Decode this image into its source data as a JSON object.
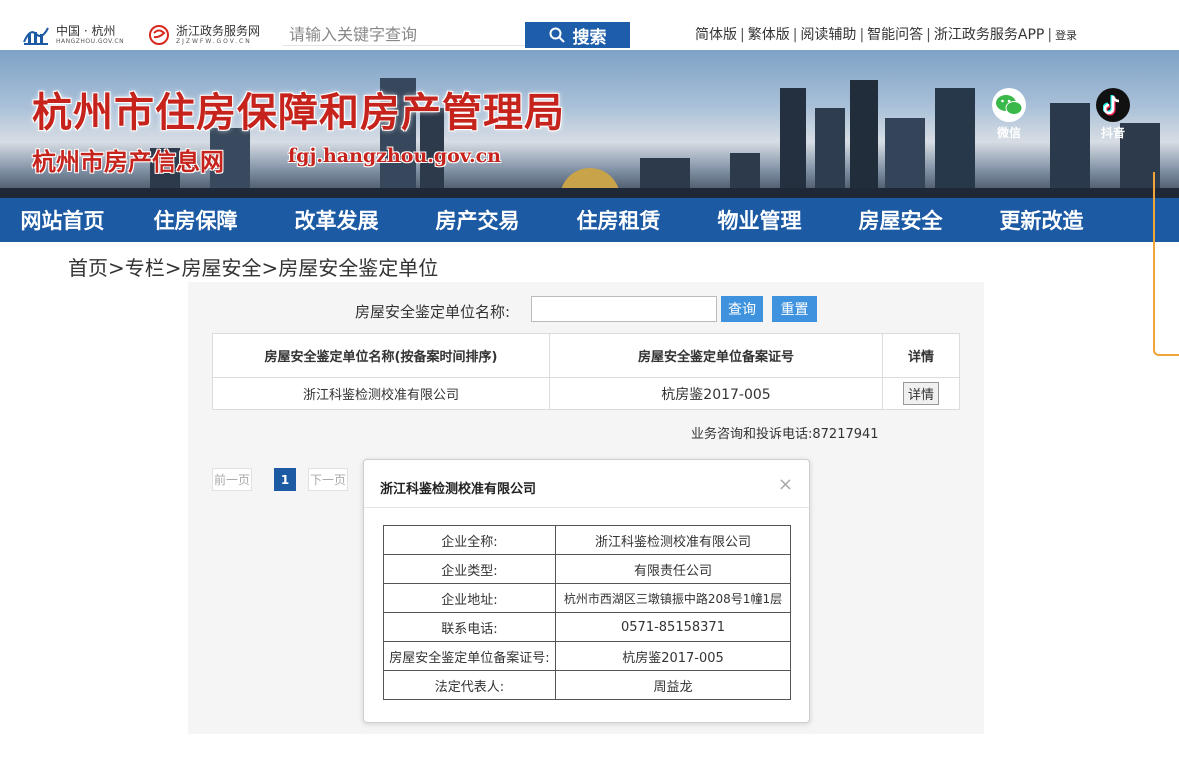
{
  "topbar": {
    "logo1": {
      "line1": "中国 · 杭州",
      "line2": "HANGZHOU.GOV.CN"
    },
    "logo2": {
      "line1": "浙江政务服务网",
      "line2": "ZJZWFW.GOV.CN"
    },
    "search_placeholder": "请输入关键字查询",
    "search_button": "搜索",
    "links": [
      "简体版",
      "繁体版",
      "阅读辅助",
      "智能问答",
      "浙江政务服务APP"
    ],
    "login": "登录"
  },
  "banner": {
    "title": "杭州市住房保障和房产管理局",
    "subtitle": "杭州市房产信息网",
    "domain": "fgj.hangzhou.gov.cn",
    "wechat": "微信",
    "douyin": "抖音"
  },
  "nav": [
    "网站首页",
    "住房保障",
    "改革发展",
    "房产交易",
    "住房租赁",
    "物业管理",
    "房屋安全",
    "更新改造"
  ],
  "breadcrumb": "首页>专栏>房屋安全>房屋安全鉴定单位",
  "filter": {
    "label": "房屋安全鉴定单位名称:",
    "value": "",
    "query_button": "查询",
    "reset_button": "重置"
  },
  "table": {
    "headers": [
      "房屋安全鉴定单位名称(按备案时间排序)",
      "房屋安全鉴定单位备案证号",
      "详情"
    ],
    "rows": [
      {
        "name": "浙江科鉴检测校准有限公司",
        "cert": "杭房鉴2017-005",
        "detail": "详情"
      }
    ]
  },
  "hotline": "业务咨询和投诉电话:87217941",
  "pager": {
    "prev": "前一页",
    "current": "1",
    "next": "下一页"
  },
  "modal": {
    "title": "浙江科鉴检测校准有限公司",
    "close": "×",
    "rows": [
      {
        "k": "企业全称:",
        "v": "浙江科鉴检测校准有限公司"
      },
      {
        "k": "企业类型:",
        "v": "有限责任公司"
      },
      {
        "k": "企业地址:",
        "v": "杭州市西湖区三墩镇振中路208号1幢1层"
      },
      {
        "k": "联系电话:",
        "v": "0571-85158371"
      },
      {
        "k": "房屋安全鉴定单位备案证号:",
        "v": "杭房鉴2017-005"
      },
      {
        "k": "法定代表人:",
        "v": "周益龙"
      }
    ]
  },
  "colors": {
    "nav_blue": "#1c5aa4",
    "button_blue": "#3f92dd",
    "title_red": "#c6231d",
    "accent_orange": "#f0a43a"
  }
}
